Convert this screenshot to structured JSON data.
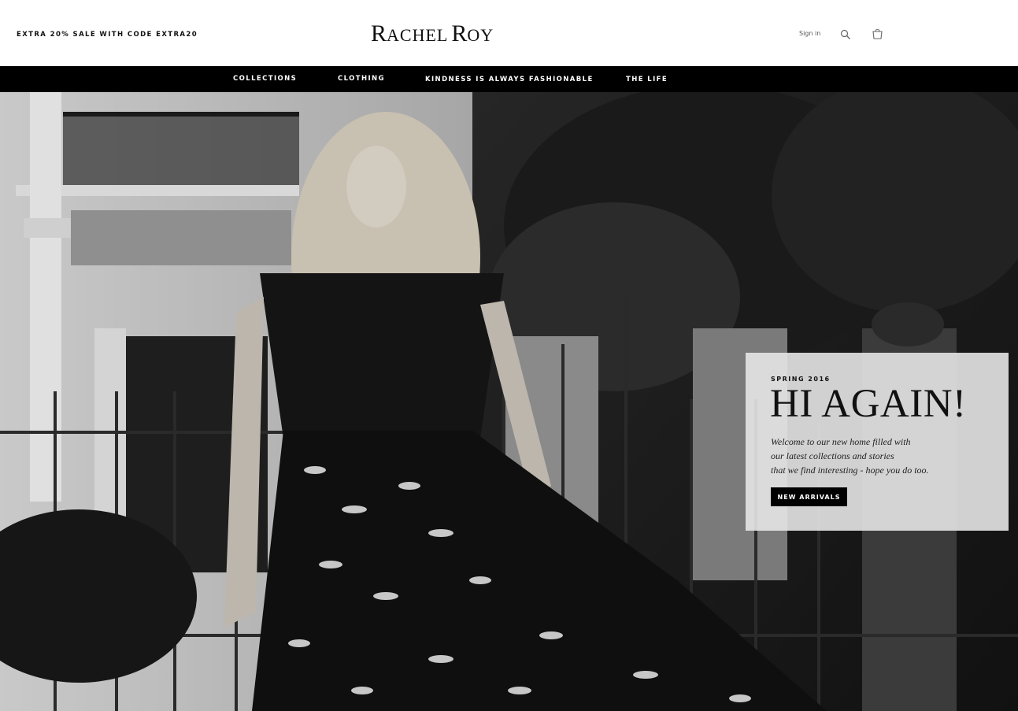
{
  "header": {
    "promo_text": "EXTRA 20% SALE WITH CODE EXTRA20",
    "logo_initial_1": "R",
    "logo_rest_1": "ACHEL",
    "logo_initial_2": "R",
    "logo_rest_2": "OY",
    "signin_label": "Sign in",
    "search_icon": "search-icon",
    "cart_icon": "shopping-bag-icon"
  },
  "nav": {
    "items": [
      {
        "label": "COLLECTIONS"
      },
      {
        "label": "CLOTHING"
      },
      {
        "label": "KINDNESS IS ALWAYS FASHIONABLE"
      },
      {
        "label": "THE LIFE"
      }
    ]
  },
  "hero": {
    "season": "SPRING 2016",
    "headline": "HI AGAIN!",
    "body_lines": [
      "Welcome to our new home filled with",
      "our latest collections and stories",
      "that we find interesting - hope you do too."
    ],
    "cta_label": "NEW ARRIVALS"
  },
  "colors": {
    "nav_background": "#000000",
    "panel_background": "#e6e6e6",
    "cta_background": "#000000"
  }
}
